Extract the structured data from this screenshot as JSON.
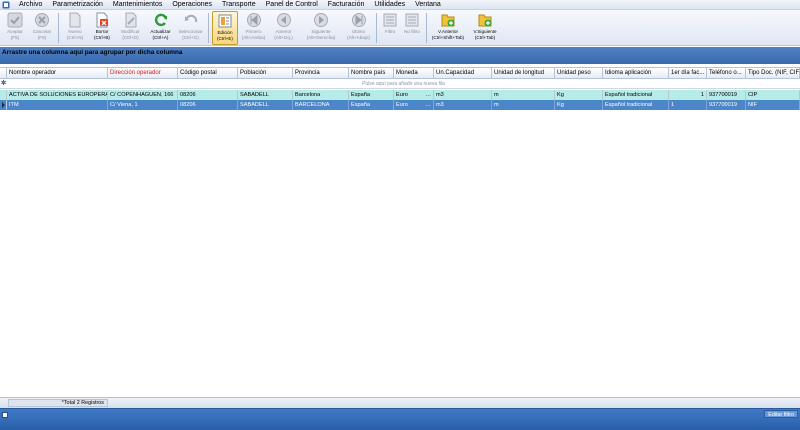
{
  "menu": {
    "items": [
      "Archivo",
      "Parametrización",
      "Mantenimientos",
      "Operaciones",
      "Transporte",
      "Panel de Control",
      "Facturación",
      "Utilidades",
      "Ventana"
    ]
  },
  "toolbar": {
    "buttons": [
      {
        "label": "Aceptar",
        "shortcut": "(F5)",
        "icon": "check-icon",
        "state": "disabled"
      },
      {
        "label": "Cancelar",
        "shortcut": "(F8)",
        "icon": "cancel-icon",
        "state": "disabled"
      },
      {
        "label": "Nuevo",
        "shortcut": "(Ctrl+N)",
        "icon": "new-document-icon",
        "state": "disabled"
      },
      {
        "label": "Borrar",
        "shortcut": "(Ctrl+B)",
        "icon": "delete-icon",
        "state": "enabled"
      },
      {
        "label": "Modificar",
        "shortcut": "(Ctrl+D)",
        "icon": "edit-icon",
        "state": "disabled"
      },
      {
        "label": "Actualizar",
        "shortcut": "(Ctrl+A)",
        "icon": "refresh-icon",
        "state": "enabled"
      },
      {
        "label": "Seleccionar",
        "shortcut": "(Ctrl+G)",
        "icon": "select-icon",
        "state": "disabled"
      },
      {
        "label": "Edición",
        "shortcut": "(Ctrl+E)",
        "icon": "edition-icon",
        "state": "active"
      },
      {
        "label": "Primero",
        "shortcut": "(Alt+Arriba)",
        "icon": "first-icon",
        "state": "disabled"
      },
      {
        "label": "Anterior",
        "shortcut": "(Alt+Izq.)",
        "icon": "previous-icon",
        "state": "disabled"
      },
      {
        "label": "Siguiente",
        "shortcut": "(Alt+Derecha)",
        "icon": "next-icon",
        "state": "disabled"
      },
      {
        "label": "Último",
        "shortcut": "(Alt+Abajo)",
        "icon": "last-icon",
        "state": "disabled"
      },
      {
        "label": "Filtro",
        "shortcut": "",
        "icon": "filter-icon",
        "state": "disabled"
      },
      {
        "label": "No filtro",
        "shortcut": "",
        "icon": "no-filter-icon",
        "state": "disabled"
      },
      {
        "label": "V.Anterior",
        "shortcut": "(Ctrl+Shift+Tab)",
        "icon": "prev-window-icon",
        "state": "enabled"
      },
      {
        "label": "V.Siguiente",
        "shortcut": "(Ctrl+Tab)",
        "icon": "next-window-icon",
        "state": "enabled"
      }
    ]
  },
  "groupby": {
    "text": "Arrastre una columna aquí para agrupar por dicha columna"
  },
  "grid": {
    "columns": [
      {
        "label": "Nombre operador",
        "red": false
      },
      {
        "label": "Dirección operador",
        "red": true
      },
      {
        "label": "Código postal",
        "red": false
      },
      {
        "label": "Población",
        "red": false
      },
      {
        "label": "Provincia",
        "red": false
      },
      {
        "label": "Nombre país",
        "red": false
      },
      {
        "label": "Moneda",
        "red": false
      },
      {
        "label": "Un.Capacidad",
        "red": false
      },
      {
        "label": "Unidad de longitud",
        "red": false
      },
      {
        "label": "Unidad peso",
        "red": false
      },
      {
        "label": "Idioma aplicación",
        "red": false
      },
      {
        "label": "1er día fac...",
        "red": false
      },
      {
        "label": "Teléfono o...",
        "red": false
      },
      {
        "label": "Tipo Doc. (NIF, CIF...)",
        "red": false
      }
    ],
    "new_row_hint": "Pulse aquí para añadir una nueva fila",
    "rows": [
      [
        "ACTIVA DE SOLUCIONES EUROPERAS",
        "C/ COPENHAGUEN, 166",
        "08206",
        "SABADELL",
        "Barcelona",
        "España",
        "Euro",
        "m3",
        "m",
        "Kg",
        "Español tradicional",
        "1",
        "937700019",
        "CIP"
      ],
      [
        "ITM",
        "C/ Viena, 1",
        "08206",
        "SABADELL",
        "BARCELONA",
        "España",
        "Euro",
        "m3",
        "m",
        "Kg",
        "Español tradicional",
        "1",
        "937700019",
        "NIF"
      ]
    ]
  },
  "footer": {
    "total": "*Total 2 Registros",
    "editar_filtro": "Editar filtro"
  },
  "colors": {
    "selected_row": "#4a86c8",
    "highlight_row": "#b6ece8",
    "groupby_panel": "#3a6aad",
    "required_column": "#d31b1b"
  }
}
